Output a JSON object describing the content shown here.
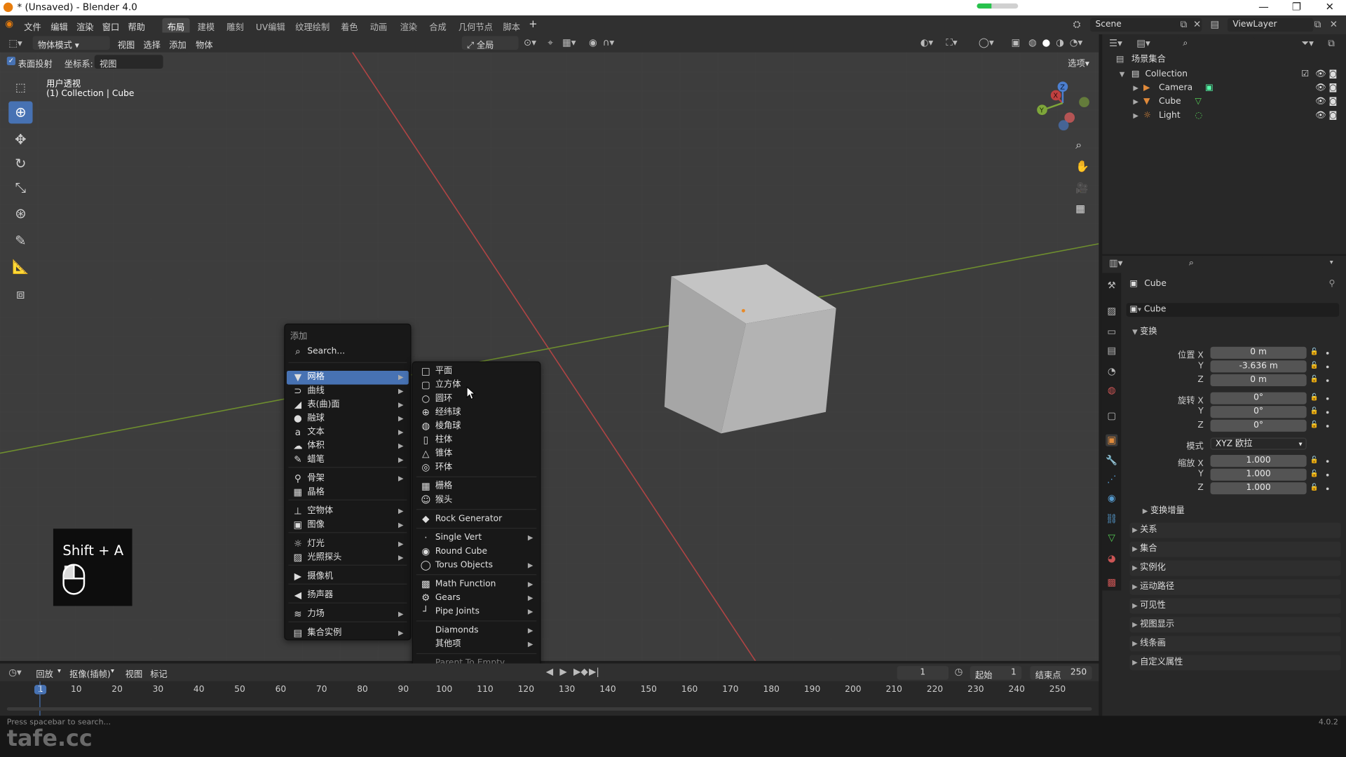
{
  "window": {
    "title": "* (Unsaved) - Blender 4.0",
    "upload_progress": 0.35,
    "minimize_icon": "minimize-icon",
    "maximize_icon": "restore-icon",
    "close_icon": "close-icon"
  },
  "menubar": {
    "items": [
      "文件",
      "编辑",
      "渲染",
      "窗口",
      "帮助"
    ]
  },
  "workspaces": {
    "tabs": [
      "布局",
      "建模",
      "雕刻",
      "UV编辑",
      "纹理绘制",
      "着色",
      "动画",
      "渲染",
      "合成",
      "几何节点",
      "脚本"
    ],
    "active": 0,
    "add": "+"
  },
  "scene": {
    "name": "Scene",
    "view_layer": "ViewLayer"
  },
  "viewport": {
    "mode": "物体模式",
    "menus": [
      "视图",
      "选择",
      "添加",
      "物体"
    ],
    "transform_orientation": "全局",
    "options_label": "选项",
    "snap_checkbox_label": "表面投射",
    "coord_label": "坐标系:",
    "coord_value": "视图",
    "view_name": "用户透视",
    "view_context": "(1) Collection | Cube",
    "colors": {
      "x_axis": "#c84848",
      "y_axis": "#7ba33b",
      "bg": "#3d3d3d"
    }
  },
  "add_menu": {
    "title": "添加",
    "search_placeholder": "Search...",
    "items": [
      {
        "label": "网格",
        "icon": "▼",
        "sub": true,
        "selected": true
      },
      {
        "label": "曲线",
        "icon": "⊃",
        "sub": true
      },
      {
        "label": "表(曲)面",
        "icon": "◢",
        "sub": true
      },
      {
        "label": "融球",
        "icon": "●",
        "sub": true
      },
      {
        "label": "文本",
        "icon": "a",
        "sub": true
      },
      {
        "label": "体积",
        "icon": "☁",
        "sub": true
      },
      {
        "label": "蜡笔",
        "icon": "✎",
        "sub": true
      },
      {
        "label": "骨架",
        "icon": "⚲",
        "sub": true
      },
      {
        "label": "晶格",
        "icon": "▦",
        "sub": false
      },
      {
        "label": "空物体",
        "icon": "⊥",
        "sub": true
      },
      {
        "label": "图像",
        "icon": "▣",
        "sub": true
      },
      {
        "label": "灯光",
        "icon": "☼",
        "sub": true
      },
      {
        "label": "光照探头",
        "icon": "▨",
        "sub": true
      },
      {
        "label": "摄像机",
        "icon": "▶",
        "sub": false
      },
      {
        "label": "扬声器",
        "icon": "◀",
        "sub": false
      },
      {
        "label": "力场",
        "icon": "≋",
        "sub": true
      },
      {
        "label": "集合实例",
        "icon": "▤",
        "sub": true
      }
    ]
  },
  "mesh_menu": {
    "items": [
      {
        "label": "平面",
        "icon": "□"
      },
      {
        "label": "立方体",
        "icon": "▢"
      },
      {
        "label": "圆环",
        "icon": "○"
      },
      {
        "label": "经纬球",
        "icon": "⊕"
      },
      {
        "label": "棱角球",
        "icon": "◍"
      },
      {
        "label": "柱体",
        "icon": "▯"
      },
      {
        "label": "锥体",
        "icon": "△"
      },
      {
        "label": "环体",
        "icon": "◎"
      },
      {
        "label": "栅格",
        "icon": "▦"
      },
      {
        "label": "猴头",
        "icon": "☺"
      },
      {
        "label": "Rock Generator",
        "icon": "◆"
      },
      {
        "label": "Single Vert",
        "icon": "·",
        "sub": true
      },
      {
        "label": "Round Cube",
        "icon": "◉"
      },
      {
        "label": "Torus Objects",
        "icon": "◯",
        "sub": true
      },
      {
        "label": "Math Function",
        "icon": "▩",
        "sub": true
      },
      {
        "label": "Gears",
        "icon": "⚙",
        "sub": true
      },
      {
        "label": "Pipe Joints",
        "icon": "┘",
        "sub": true
      },
      {
        "label": "Diamonds",
        "icon": "",
        "sub": true
      },
      {
        "label": "其他项",
        "icon": "",
        "sub": true
      },
      {
        "label": "Parent To Empty",
        "icon": "",
        "dim": true
      }
    ]
  },
  "key_hint": {
    "keys": "Shift + A",
    "icon": "mouse-icon"
  },
  "timeline": {
    "menus": [
      "回放",
      "抠像(插帧)",
      "视图",
      "标记"
    ],
    "current_frame": "1",
    "start_label": "起始",
    "start": "1",
    "end_label": "结束点",
    "end": "250",
    "ticks": [
      "1",
      "10",
      "20",
      "30",
      "40",
      "50",
      "60",
      "70",
      "80",
      "90",
      "100",
      "110",
      "120",
      "130",
      "140",
      "150",
      "160",
      "170",
      "180",
      "190",
      "200",
      "210",
      "220",
      "230",
      "240",
      "250"
    ]
  },
  "statusbar": {
    "hint": "Press spacebar to search...",
    "version": "4.0.2",
    "watermark": "tafe.cc"
  },
  "outliner": {
    "root": "场景集合",
    "collection": "Collection",
    "objects": [
      "Camera",
      "Cube",
      "Light"
    ]
  },
  "properties": {
    "object_name": "Cube",
    "object_field": "Cube",
    "transform_section": "变换",
    "location": {
      "label": "位置 X",
      "x": "0 m",
      "y": "-3.636 m",
      "z": "0 m"
    },
    "rotation": {
      "label": "旋转 X",
      "x": "0°",
      "y": "0°",
      "z": "0°"
    },
    "mode_label": "模式",
    "mode_value": "XYZ 欧拉",
    "scale": {
      "label": "缩放 X",
      "x": "1.000",
      "y": "1.000",
      "z": "1.000"
    },
    "axis_y": "Y",
    "axis_z": "Z",
    "delta": "变换增量",
    "sections": [
      "关系",
      "集合",
      "实例化",
      "运动路径",
      "可见性",
      "视图显示",
      "线条画",
      "自定义属性"
    ]
  }
}
